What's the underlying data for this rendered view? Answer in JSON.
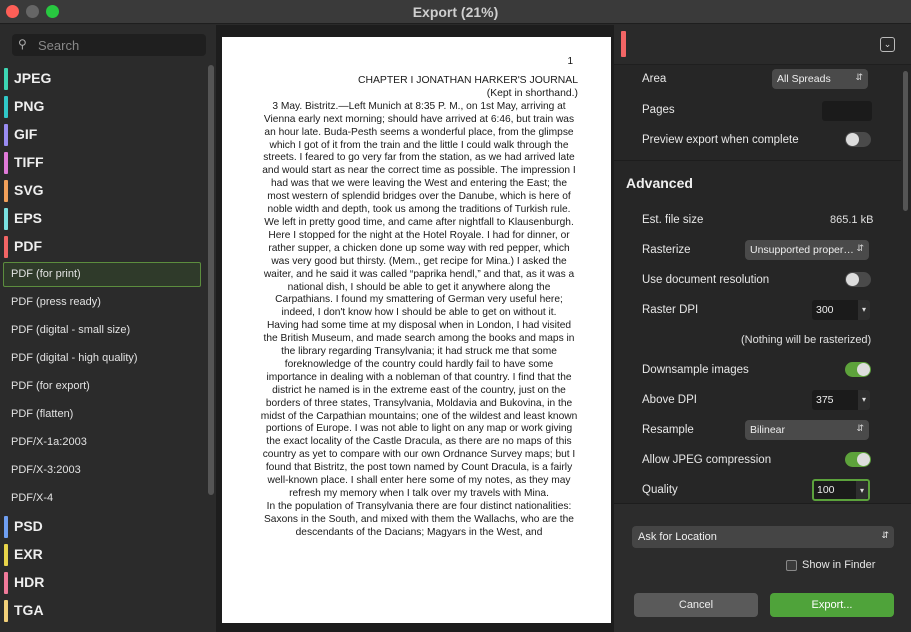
{
  "window": {
    "title": "Export (21%)"
  },
  "search": {
    "placeholder": "Search"
  },
  "formats": {
    "jpeg": {
      "label": "JPEG",
      "color": "#3dd6b3"
    },
    "png": {
      "label": "PNG",
      "color": "#30c8c8"
    },
    "gif": {
      "label": "GIF",
      "color": "#9a8cf2"
    },
    "tiff": {
      "label": "TIFF",
      "color": "#e07ad8"
    },
    "svg": {
      "label": "SVG",
      "color": "#f2a05a"
    },
    "eps": {
      "label": "EPS",
      "color": "#7ae0e0"
    },
    "pdf": {
      "label": "PDF",
      "color": "#f26565"
    },
    "psd": {
      "label": "PSD",
      "color": "#6f9ff2"
    },
    "exr": {
      "label": "EXR",
      "color": "#e8d44a"
    },
    "hdr": {
      "label": "HDR",
      "color": "#f07a9a"
    },
    "tga": {
      "label": "TGA",
      "color": "#f2d07a"
    }
  },
  "presets": [
    "PDF (for print)",
    "PDF (press ready)",
    "PDF (digital - small size)",
    "PDF (digital - high quality)",
    "PDF (for export)",
    "PDF (flatten)",
    "PDF/X-1a:2003",
    "PDF/X-3:2003",
    "PDF/X-4"
  ],
  "preview": {
    "page_number": "1",
    "paragraphs": [
      "CHAPTER I JONATHAN HARKER'S JOURNAL",
      "(Kept in shorthand.)",
      "3 May. Bistritz.—Left Munich at 8:35 P. M., on 1st May, arriving at Vienna early next morning; should have arrived at 6:46, but train was an hour late. Buda-Pesth seems a wonderful place, from the glimpse which I got of it from the train and the little I could walk through the streets. I feared to go very far from the station, as we had arrived late and would start as near the correct time as possible. The impression I had was that we were leaving the West and entering the East; the most western of splendid bridges over the Danube, which is here of noble width and depth, took us among the traditions of Turkish rule.",
      "We left in pretty good time, and came after nightfall to Klausenburgh. Here I stopped for the night at the Hotel Royale. I had for dinner, or rather supper, a chicken done up some way with red pepper, which was very good but thirsty. (Mem., get recipe for Mina.) I asked the waiter, and he said it was called “paprika hendl,” and that, as it was a national dish, I should be able to get it anywhere along the Carpathians. I found my smattering of German very useful here; indeed, I don't know how I should be able to get on without it.",
      "Having had some time at my disposal when in London, I had visited the British Museum, and made search among the books and maps in the library regarding Transylvania; it had struck me that some foreknowledge of the country could hardly fail to have some importance in dealing with a nobleman of that country. I find that the district he named is in the extreme east of the country, just on the borders of three states, Transylvania, Moldavia and Bukovina, in the midst of the Carpathian mountains; one of the wildest and least known portions of Europe. I was not able to light on any map or work giving the exact locality of the Castle Dracula, as there are no maps of this country as yet to compare with our own Ordnance Survey maps; but I found that Bistritz, the post town named by Count Dracula, is a fairly well-known place. I shall enter here some of my notes, as they may refresh my memory when I talk over my travels with Mina.",
      "In the population of Transylvania there are four distinct nationalities: Saxons in the South, and mixed with them the Wallachs, who are the descendants of the Dacians; Magyars in the West, and"
    ]
  },
  "settings": {
    "area_label": "Area",
    "area_value": "All Spreads",
    "pages_label": "Pages",
    "preview_label": "Preview export when complete",
    "preview_on": false,
    "advanced_title": "Advanced",
    "filesize_label": "Est. file size",
    "filesize_value": "865.1 kB",
    "rasterize_label": "Rasterize",
    "rasterize_value": "Unsupported proper…",
    "docres_label": "Use document resolution",
    "docres_on": false,
    "dpi_label": "Raster DPI",
    "dpi_value": "300",
    "raster_note": "(Nothing will be rasterized)",
    "downsample_label": "Downsample images",
    "downsample_on": true,
    "above_label": "Above DPI",
    "above_value": "375",
    "resample_label": "Resample",
    "resample_value": "Bilinear",
    "jpeg_label": "Allow JPEG compression",
    "jpeg_on": true,
    "quality_label": "Quality",
    "quality_value": "100"
  },
  "footer": {
    "location": "Ask for Location",
    "show_finder": "Show in Finder",
    "cancel": "Cancel",
    "export": "Export..."
  }
}
